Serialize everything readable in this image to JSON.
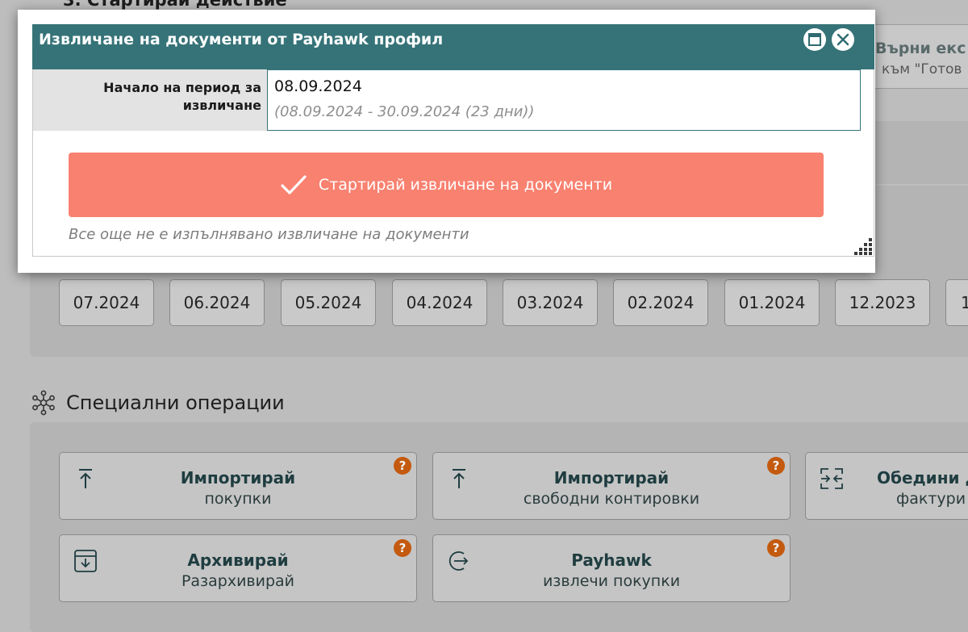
{
  "background": {
    "step_heading": "3. Стартирай действие",
    "top_right_button": {
      "line1": "Върни екс",
      "line2": "към \"Готов"
    },
    "months": [
      "07.2024",
      "06.2024",
      "05.2024",
      "04.2024",
      "03.2024",
      "02.2024",
      "01.2024",
      "12.2023",
      "1"
    ],
    "special_operations": {
      "title": "Специални операции",
      "buttons": [
        {
          "line1": "Импортирай",
          "line2": "покупки",
          "icon": "upload-icon",
          "help": "?"
        },
        {
          "line1": "Импортирай",
          "line2": "свободни контировки",
          "icon": "upload-icon",
          "help": "?"
        },
        {
          "line1": "Обедини д",
          "line2": "фактури",
          "icon": "merge-icon",
          "help": ""
        },
        {
          "line1": "Архивирай",
          "line2": "Разархивирай",
          "icon": "archive-icon",
          "help": "?"
        },
        {
          "line1": "Payhawk",
          "line2": "извлечи покупки",
          "icon": "login-arrow-icon",
          "help": "?"
        }
      ]
    }
  },
  "modal": {
    "title": "Извличане на документи от Payhawk профил",
    "field_label_line1": "Начало на период за",
    "field_label_line2": "извличане",
    "field_value": "08.09.2024",
    "field_range": "(08.09.2024 - 30.09.2024 (23 дни))",
    "start_button_label": "Стартирай извличане на документи",
    "status_text": "Все още не е изпълнявано извличане на документи"
  },
  "colors": {
    "header": "#367378",
    "start_button": "#f98170",
    "help_badge": "#c45a0f",
    "overlay": "#bdbdbd"
  }
}
